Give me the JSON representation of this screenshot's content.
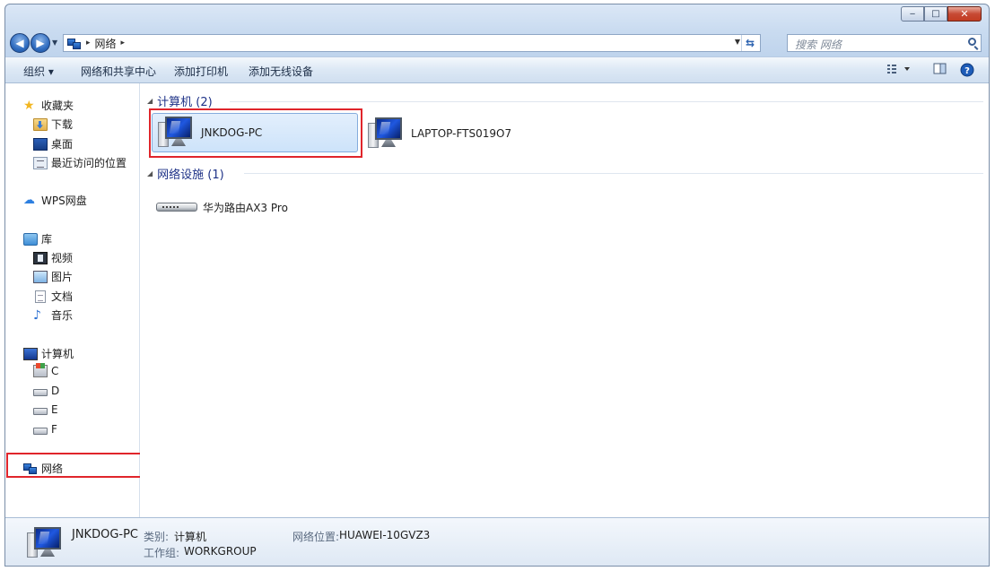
{
  "window": {
    "caption": {
      "minimize": "‒",
      "maximize": "□",
      "close": "✕"
    }
  },
  "address": {
    "path_root_sep": "▸",
    "location": "网络",
    "trail_sep": "▸",
    "search_placeholder": "搜索 网络"
  },
  "toolbar": {
    "organize": "组织 ▾",
    "network_sharing_center": "网络和共享中心",
    "add_printer": "添加打印机",
    "add_wireless_device": "添加无线设备"
  },
  "sidebar": {
    "favorites": "收藏夹",
    "downloads": "下载",
    "desktop": "桌面",
    "recent_places": "最近访问的位置",
    "wps_drive": "WPS网盘",
    "libraries": "库",
    "videos": "视频",
    "pictures": "图片",
    "documents": "文档",
    "music": "音乐",
    "computer": "计算机",
    "drive_c": "C",
    "drive_d": "D",
    "drive_e": "E",
    "drive_f": "F",
    "network": "网络"
  },
  "groups": {
    "computers": {
      "header": "计算机 (2)",
      "items": [
        "JNKDOG-PC",
        "LAPTOP-FTS019O7"
      ]
    },
    "infrastructure": {
      "header": "网络设施 (1)",
      "items": [
        "华为路由AX3 Pro"
      ]
    }
  },
  "details": {
    "name": "JNKDOG-PC",
    "category_label": "类别:",
    "category_value": "计算机",
    "workgroup_label": "工作组:",
    "workgroup_value": "WORKGROUP",
    "network_location_label": "网络位置:",
    "network_location_value": "HUAWEI-10GVZ3"
  },
  "colors": {
    "highlight_box": "#e0252b",
    "group_header": "#1e3287",
    "selection": "#cde3fa"
  }
}
